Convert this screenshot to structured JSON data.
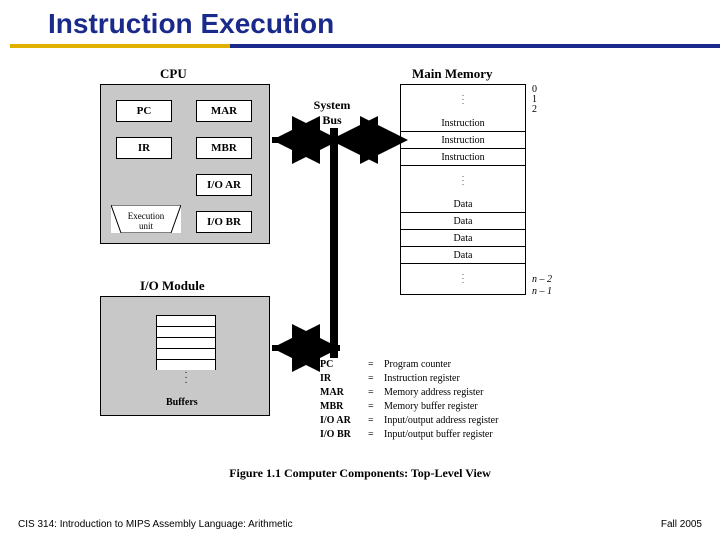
{
  "title": "Instruction Execution",
  "cpu": {
    "label": "CPU",
    "pc": "PC",
    "mar": "MAR",
    "ir": "IR",
    "mbr": "MBR",
    "ioar": "I/O AR",
    "iobr": "I/O BR",
    "exec": "Execution\nunit"
  },
  "sysbus": "System\nBus",
  "memory": {
    "label": "Main Memory",
    "rows": [
      "Instruction",
      "Instruction",
      "Instruction",
      "Data",
      "Data",
      "Data",
      "Data"
    ],
    "idx_top": [
      "0",
      "1",
      "2"
    ],
    "idx_bot": [
      "n – 2",
      "n – 1"
    ]
  },
  "io": {
    "label": "I/O Module",
    "buffers": "Buffers"
  },
  "legend": [
    {
      "k": "PC",
      "v": "Program counter"
    },
    {
      "k": "IR",
      "v": "Instruction register"
    },
    {
      "k": "MAR",
      "v": "Memory address register"
    },
    {
      "k": "MBR",
      "v": "Memory buffer register"
    },
    {
      "k": "I/O AR",
      "v": "Input/output address register"
    },
    {
      "k": "I/O BR",
      "v": "Input/output buffer register"
    }
  ],
  "caption": "Figure 1.1   Computer Components: Top-Level View",
  "footer_left": "CIS 314:  Introduction to MIPS Assembly Language:   Arithmetic",
  "footer_right": "Fall 2005"
}
